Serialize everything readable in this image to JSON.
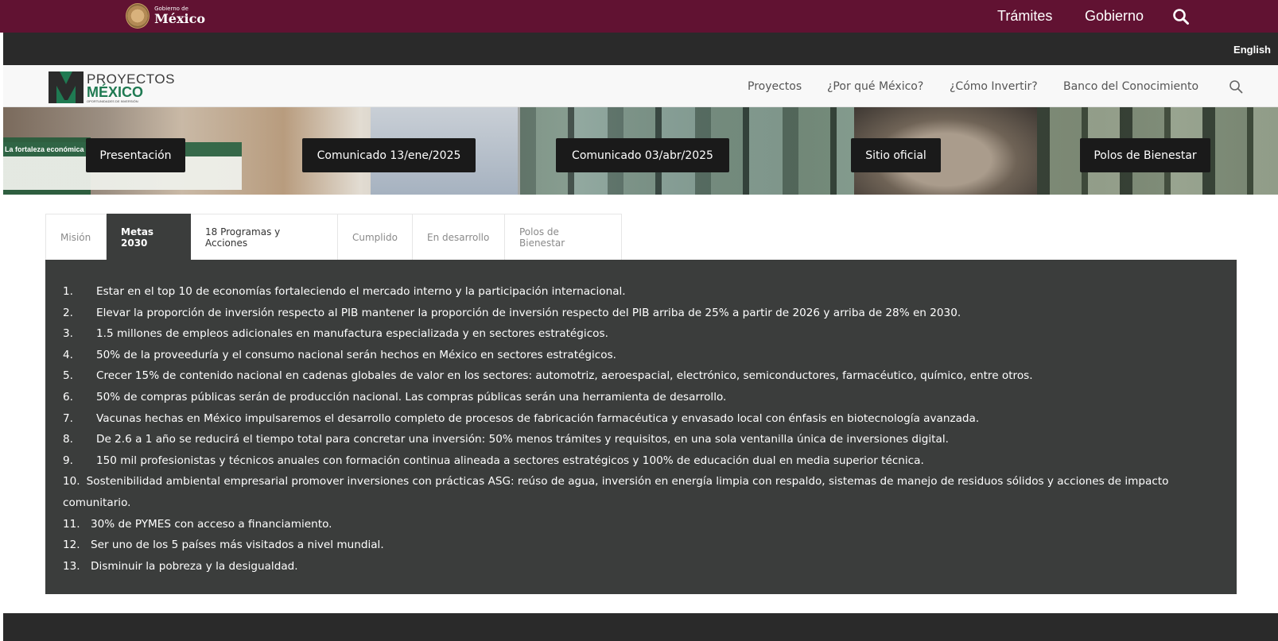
{
  "gov_bar": {
    "logo_small": "Gobierno de",
    "logo_big": "México",
    "links": [
      "Trámites",
      "Gobierno"
    ]
  },
  "lang_bar": {
    "language": "English"
  },
  "site_nav": {
    "brand_line1": "PROYECTOS",
    "brand_line2": "MÉXICO",
    "brand_line3": "OPORTUNIDADES DE INVERSIÓN",
    "links": [
      "Proyectos",
      "¿Por qué México?",
      "¿Cómo Invertir?",
      "Banco del Conocimiento"
    ]
  },
  "banner": {
    "strip_text": "La fortaleza económica",
    "buttons": [
      "Presentación",
      "Comunicado 13/ene/2025",
      "Comunicado 03/abr/2025",
      "Sitio oficial",
      "Polos de Bienestar"
    ]
  },
  "tabs": {
    "items": [
      "Misión",
      "Metas 2030",
      "18 Programas y Acciones",
      "Cumplido",
      "En desarrollo",
      "Polos de Bienestar"
    ],
    "active": "Metas 2030"
  },
  "goals": [
    {
      "num": "1.",
      "text": "Estar en el top 10 de economías fortaleciendo el mercado interno y la participación internacional."
    },
    {
      "num": "2.",
      "text": "Elevar la proporción de inversión respecto al PIB mantener la proporción de inversión respecto del PIB arriba de 25% a partir de 2026 y arriba de 28% en 2030."
    },
    {
      "num": "3.",
      "text": "1.5 millones de empleos adicionales en manufactura especializada y en sectores estratégicos."
    },
    {
      "num": "4.",
      "text": "50% de la proveeduría y el consumo nacional serán hechos en México en sectores estratégicos."
    },
    {
      "num": "5.",
      "text": "Crecer 15% de contenido nacional en cadenas globales de valor en los sectores: automotriz, aeroespacial, electrónico, semiconductores, farmacéutico, químico, entre otros."
    },
    {
      "num": "6.",
      "text": "50% de compras públicas serán de producción nacional. Las compras públicas serán una herramienta de desarrollo."
    },
    {
      "num": "7.",
      "text": "Vacunas hechas en México impulsaremos el desarrollo completo de procesos de fabricación farmacéutica y envasado local con énfasis en biotecnología avanzada."
    },
    {
      "num": "8.",
      "text": "De 2.6 a 1 año se reducirá el tiempo total para concretar una inversión: 50% menos trámites y requisitos, en una sola ventanilla única de inversiones digital."
    },
    {
      "num": "9.",
      "text": "150 mil profesionistas y técnicos anuales con formación continua alineada a sectores estratégicos y 100% de educación dual en media superior técnica."
    },
    {
      "num": "10.",
      "text": "Sostenibilidad ambiental empresarial promover inversiones con prácticas ASG: reúso de agua, inversión en energía limpia con respaldo, sistemas de manejo de residuos sólidos y acciones de impacto comunitario."
    },
    {
      "num": "11.",
      "text": "30% de PYMES con acceso a financiamiento."
    },
    {
      "num": "12.",
      "text": "Ser uno de los 5 países más visitados a nivel mundial."
    },
    {
      "num": "13.",
      "text": "Disminuir la pobreza y la desigualdad."
    }
  ],
  "colors": {
    "gov_bar": "#611232",
    "dark_bar": "#2a2a2a",
    "panel": "#3b3d3c",
    "brand_green": "#1f7a52"
  },
  "icons": {
    "gov_search": "search-icon",
    "nav_search": "search-icon",
    "seal": "mexico-seal-icon"
  }
}
